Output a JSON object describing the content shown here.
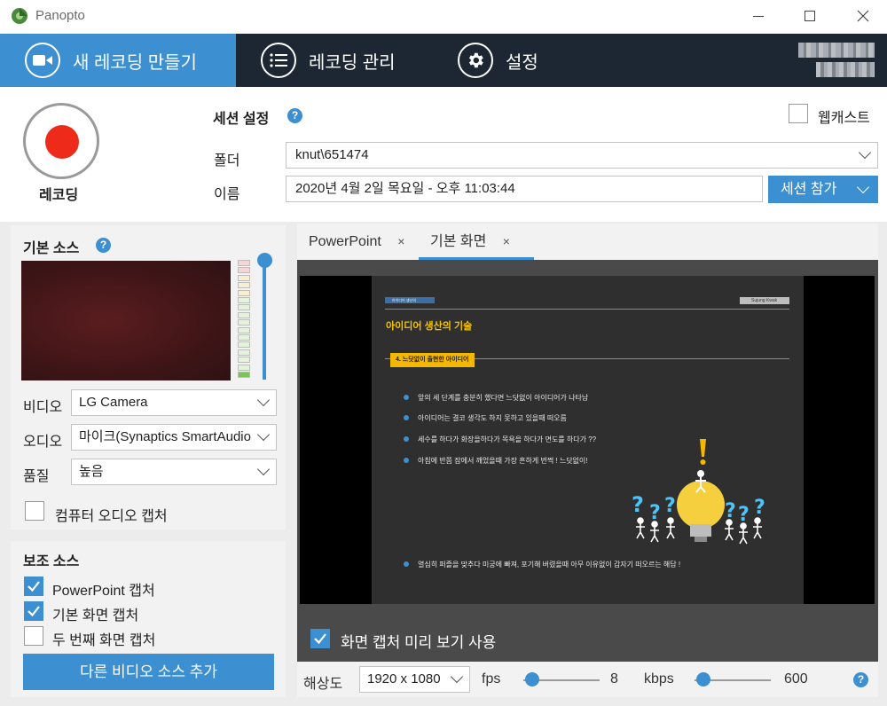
{
  "app": {
    "title": "Panopto"
  },
  "nav": {
    "tabs": [
      {
        "label": "새 레코딩 만들기",
        "icon": "video-camera-icon",
        "active": true
      },
      {
        "label": "레코딩 관리",
        "icon": "list-icon",
        "active": false
      },
      {
        "label": "설정",
        "icon": "gear-icon",
        "active": false
      }
    ]
  },
  "record": {
    "label": "레코딩"
  },
  "session": {
    "title": "세션 설정",
    "folder_label": "폴더",
    "folder_value": "knut\\651474",
    "name_label": "이름",
    "name_value": "2020년 4월 2일 목요일 - 오후 11:03:44",
    "join_button": "세션 참가",
    "webcast_label": "웹캐스트",
    "webcast_checked": false
  },
  "primary": {
    "title": "기본 소스",
    "video_label": "비디오",
    "video_value": "LG Camera",
    "audio_label": "오디오",
    "audio_value": "마이크(Synaptics SmartAudio",
    "quality_label": "품질",
    "quality_value": "높음",
    "computer_audio_label": "컴퓨터 오디오 캡처",
    "computer_audio_checked": false
  },
  "secondary": {
    "title": "보조 소스",
    "items": [
      {
        "label": "PowerPoint 캡처",
        "checked": true
      },
      {
        "label": "기본 화면 캡처",
        "checked": true
      },
      {
        "label": "두 번째 화면 캡처",
        "checked": false
      }
    ],
    "add_button": "다른 비디오 소스 추가"
  },
  "preview": {
    "tabs": [
      {
        "label": "PowerPoint",
        "active": false
      },
      {
        "label": "기본 화면",
        "active": true
      }
    ],
    "close_glyph": "×",
    "use_preview_label": "화면 캡처 미리 보기 사용",
    "use_preview_checked": true
  },
  "slide": {
    "tag": "아이디어 생산의",
    "right_tag": "Sujung Kwak",
    "heading": "아이디어 생산의 기술",
    "section": "4. 느닷없이 출현한 아이디어",
    "bullets": [
      "앞의 세 단계를 충분히 했다면 느닷없이 아이디어가 나타남",
      "아이디어는 결코 생각도 하지 못하고 있을때 떠오름",
      "세수를 하다가 화장을하다가 목욕을 하다가 면도를 하다가 ??",
      "아침에 반쯤 잠에서 깨었을때 가장 흔하게 번쩍 ! 느닷없이!"
    ],
    "bottom_bullet": "열심히 퍼즐을 맞추다 미궁에 빠져, 포기해 버렸을때 아무 이유없이 갑자기 떠오르는 해답 !"
  },
  "settings_bar": {
    "resolution_label": "해상도",
    "resolution_value": "1920 x 1080",
    "fps_label": "fps",
    "fps_value": "8",
    "kbps_label": "kbps",
    "kbps_value": "600"
  },
  "colors": {
    "accent": "#3c8fd0",
    "nav_bg": "#1c2733",
    "record_red": "#ee2a1a",
    "slide_orange": "#f5b800"
  }
}
